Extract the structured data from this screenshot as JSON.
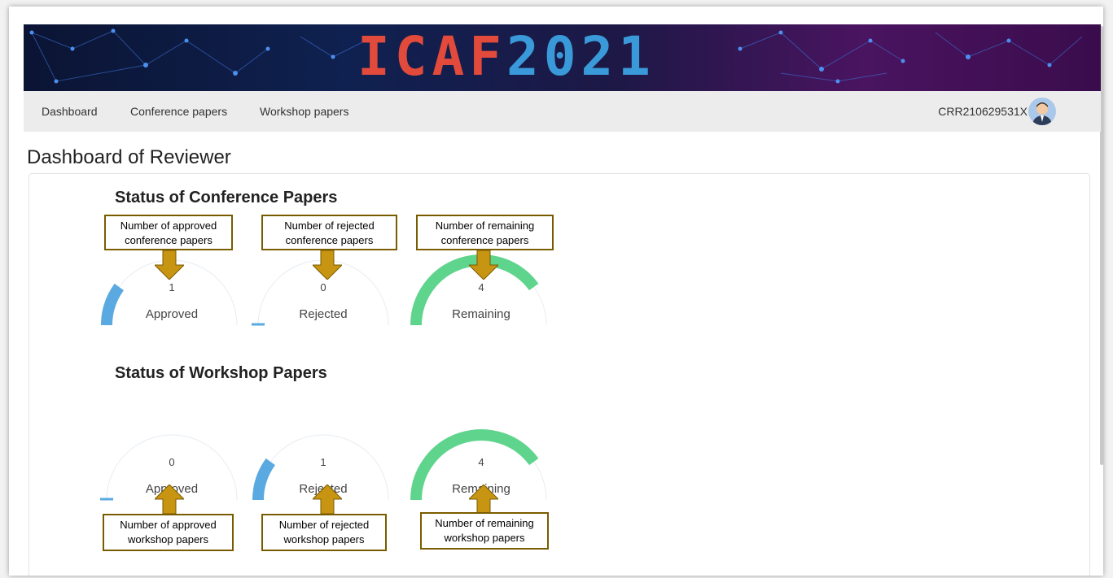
{
  "banner": {
    "title_part1": "ICAF",
    "title_part2": "2021"
  },
  "nav": {
    "items": [
      {
        "label": "Dashboard"
      },
      {
        "label": "Conference papers"
      },
      {
        "label": "Workshop papers"
      }
    ],
    "user_id": "CRR210629531X"
  },
  "page": {
    "title": "Dashboard of Reviewer"
  },
  "conference": {
    "title": "Status of Conference Papers",
    "gauges": [
      {
        "label": "Approved",
        "value": "1",
        "fill_fraction": 0.2,
        "color": "#5aa9e0"
      },
      {
        "label": "Rejected",
        "value": "0",
        "fill_fraction": 0.0,
        "color": "#5aa9e0"
      },
      {
        "label": "Remaining",
        "value": "4",
        "fill_fraction": 0.8,
        "color": "#5fd48c"
      }
    ],
    "annotations": [
      {
        "line1": "Number of approved",
        "line2": "conference papers"
      },
      {
        "line1": "Number of rejected",
        "line2": "conference papers"
      },
      {
        "line1": "Number of remaining",
        "line2": "conference papers"
      }
    ]
  },
  "workshop": {
    "title": "Status of Workshop Papers",
    "gauges": [
      {
        "label": "Approved",
        "value": "0",
        "fill_fraction": 0.0,
        "color": "#5aa9e0"
      },
      {
        "label": "Rejected",
        "value": "1",
        "fill_fraction": 0.2,
        "color": "#5aa9e0"
      },
      {
        "label": "Remaining",
        "value": "4",
        "fill_fraction": 0.8,
        "color": "#5fd48c"
      }
    ],
    "annotations": [
      {
        "line1": "Number of approved",
        "line2": "workshop papers"
      },
      {
        "line1": "Number of rejected",
        "line2": "workshop papers"
      },
      {
        "line1": "Number of remaining",
        "line2": "workshop papers"
      }
    ]
  },
  "colors": {
    "annotation_border": "#7a5c00",
    "annotation_arrow": "#c89512",
    "gauge_track": "#e6edf3"
  }
}
